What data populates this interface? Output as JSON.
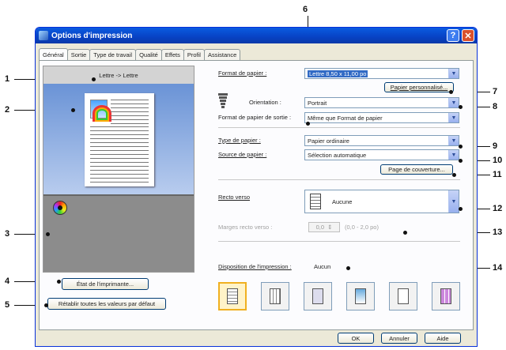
{
  "window": {
    "title": "Options d'impression",
    "help_glyph": "?",
    "close_glyph": "✕"
  },
  "tabs": [
    "Général",
    "Sortie",
    "Type de travail",
    "Qualité",
    "Effets",
    "Profil",
    "Assistance"
  ],
  "preview": {
    "caption": "Lettre -> Lettre",
    "printer_status_button": "État de l'imprimante...",
    "restore_defaults_button": "Rétablir toutes les valeurs par défaut"
  },
  "paper": {
    "format_label": "Format de papier :",
    "format_value": "Lettre  8,50 x 11,00 po",
    "custom_paper_button": "Papier personnalisé...",
    "orientation_label": "Orientation :",
    "orientation_value": "Portrait",
    "output_format_label": "Format de papier de sortie :",
    "output_format_value": "Même que Format de papier",
    "type_label": "Type de papier :",
    "type_value": "Papier ordinaire",
    "source_label": "Source de papier :",
    "source_value": "Sélection automatique",
    "cover_page_button": "Page de couverture..."
  },
  "duplex": {
    "label": "Recto verso",
    "value": "Aucune",
    "margins_label": "Marges recto verso :",
    "margins_value": "0,0",
    "margins_range": "(0,0 - 2,0 po)"
  },
  "layout": {
    "label": "Disposition de l'impression :",
    "value": "Aucun"
  },
  "footer": {
    "ok": "OK",
    "cancel": "Annuler",
    "help": "Aide"
  },
  "callouts": [
    "1",
    "2",
    "3",
    "4",
    "5",
    "6",
    "7",
    "8",
    "9",
    "10",
    "11",
    "12",
    "13",
    "14"
  ],
  "colors": {
    "title_bar": "#0842c4",
    "selection": "#316ac5",
    "dialog_bg": "#ece9d8"
  }
}
